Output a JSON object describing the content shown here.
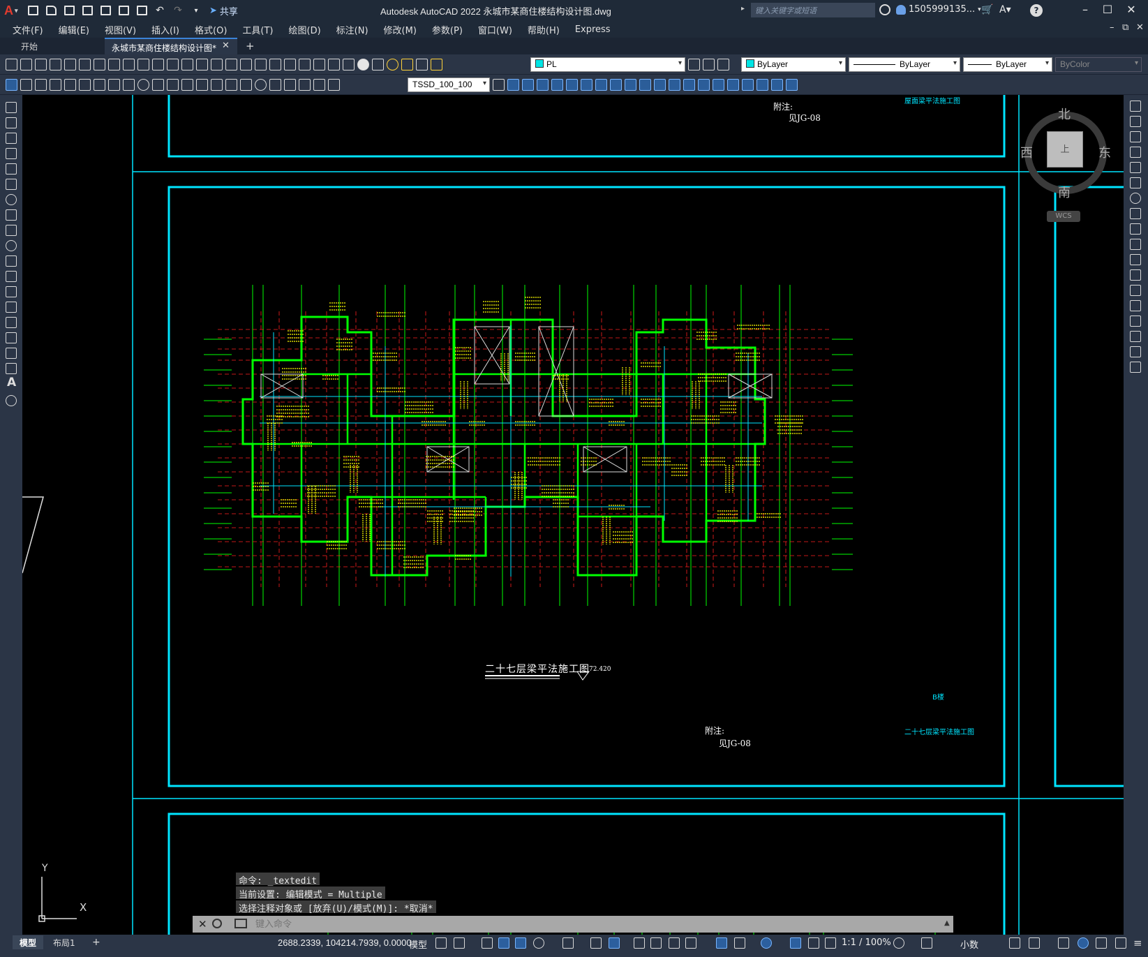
{
  "app": {
    "logo": "A",
    "window_title": "Autodesk AutoCAD 2022    永城市某商住楼结构设计图.dwg",
    "share_label": "共享",
    "search_placeholder": "键入关键字或短语",
    "user_name": "1505999135...",
    "help_label": "?"
  },
  "menu": [
    "文件(F)",
    "编辑(E)",
    "视图(V)",
    "插入(I)",
    "格式(O)",
    "工具(T)",
    "绘图(D)",
    "标注(N)",
    "修改(M)",
    "参数(P)",
    "窗口(W)",
    "帮助(H)",
    "Express"
  ],
  "tabs": {
    "start": "开始",
    "drawing": "永城市某商住楼结构设计图*"
  },
  "toolbar": {
    "layer_name": "PL",
    "color": "ByLayer",
    "linetype": "ByLayer",
    "lineweight": "ByLayer",
    "plotstyle": "ByColor",
    "dimstyle": "TSSD_100_100"
  },
  "viewcube": {
    "north": "北",
    "south": "南",
    "east": "东",
    "west": "西",
    "top": "上",
    "wcs": "WCS"
  },
  "drawing": {
    "note_top_label": "附注:",
    "note_top_ref": "见JG-08",
    "title_block_top": "屋面梁平法施工图",
    "plan_title": "二十七层梁平法施工图",
    "plan_elevation": "72.420",
    "label_b": "B楼",
    "note_bottom_label": "附注:",
    "note_bottom_ref": "见JG-08",
    "title_block_bottom": "二十七层梁平法施工图"
  },
  "command": {
    "history": [
      "命令: _textedit",
      "当前设置: 编辑模式 = Multiple",
      "选择注释对象或 [放弃(U)/模式(M)]: *取消*"
    ],
    "placeholder": "键入命令"
  },
  "status": {
    "layout_tabs": [
      "模型",
      "布局1"
    ],
    "coords": "2688.2339, 104214.7939, 0.0000",
    "space": "模型",
    "anno_scale": "1:1 / 100%",
    "units": "小数"
  },
  "ucs": {
    "x": "X",
    "y": "Y"
  },
  "colors": {
    "frame_cyan": "#00e5ff",
    "wall_green": "#00ff00",
    "axis_red": "#ff2020",
    "text_yellow": "#ffff00",
    "layer_color_swatch": "#00e5e5"
  }
}
